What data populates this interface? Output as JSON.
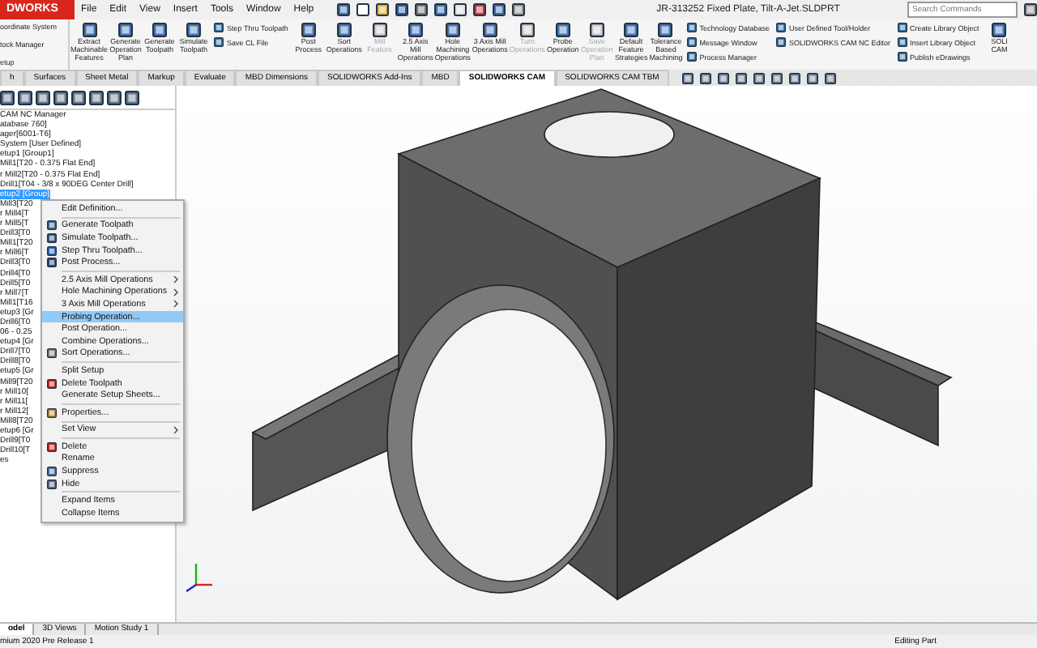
{
  "app": {
    "logo": "DWORKS",
    "menu": [
      "File",
      "Edit",
      "View",
      "Insert",
      "Tools",
      "Window",
      "Help"
    ],
    "title": "JR-313252 Fixed Plate, Tilt-A-Jet.SLDPRT",
    "search": {
      "placeholder": "Search Commands"
    }
  },
  "ribbon": {
    "left_items": [
      "oordinate System",
      "tock Manager",
      "etup"
    ],
    "buttons": [
      {
        "kind": "large",
        "label": "Extract Machinable Features",
        "disabled": false
      },
      {
        "kind": "large",
        "label": "Generate Operation Plan",
        "disabled": false
      },
      {
        "kind": "large",
        "label": "Generate Toolpath",
        "disabled": false
      },
      {
        "kind": "large",
        "label": "Simulate Toolpath",
        "disabled": false
      },
      {
        "kind": "stack",
        "items": [
          "Step Thru Toolpath",
          "Save CL File"
        ]
      },
      {
        "kind": "large",
        "label": "Post Process",
        "disabled": false
      },
      {
        "kind": "large",
        "label": "Sort Operations",
        "disabled": false
      },
      {
        "kind": "large",
        "label": "Mill Feature",
        "disabled": true
      },
      {
        "kind": "large",
        "label": "2.5 Axis Mill Operations",
        "disabled": false
      },
      {
        "kind": "large",
        "label": "Hole Machining Operations",
        "disabled": false
      },
      {
        "kind": "large",
        "label": "3 Axis Mill Operations",
        "disabled": false
      },
      {
        "kind": "large",
        "label": "Turn Operations",
        "disabled": true
      },
      {
        "kind": "large",
        "label": "Probe Operation",
        "disabled": false
      },
      {
        "kind": "large",
        "label": "Save Operation Plan",
        "disabled": true
      },
      {
        "kind": "large",
        "label": "Default Feature Strategies",
        "disabled": false
      },
      {
        "kind": "large",
        "label": "Tolerance Based Machining",
        "disabled": false
      },
      {
        "kind": "stack",
        "items": [
          "Technology Database",
          "Message Window",
          "Process Manager"
        ]
      },
      {
        "kind": "stack",
        "items": [
          "User Defined Tool/Holder",
          "SOLIDWORKS CAM NC Editor"
        ]
      },
      {
        "kind": "stack",
        "items": [
          "Create Library Object",
          "Insert Library Object",
          "Publish eDrawings"
        ]
      },
      {
        "kind": "large",
        "label": "SOLI CAM",
        "disabled": false
      }
    ]
  },
  "tabs": [
    {
      "label": "h",
      "selected": false
    },
    {
      "label": "Surfaces",
      "selected": false
    },
    {
      "label": "Sheet Metal",
      "selected": false
    },
    {
      "label": "Markup",
      "selected": false
    },
    {
      "label": "Evaluate",
      "selected": false
    },
    {
      "label": "MBD Dimensions",
      "selected": false
    },
    {
      "label": "SOLIDWORKS Add-Ins",
      "selected": false
    },
    {
      "label": "MBD",
      "selected": false
    },
    {
      "label": "SOLIDWORKS CAM",
      "selected": true
    },
    {
      "label": "SOLIDWORKS CAM TBM",
      "selected": false
    }
  ],
  "tree": {
    "items": [
      {
        "label": "CAM NC Manager",
        "selected": false
      },
      {
        "label": "atabase 760]",
        "selected": false
      },
      {
        "label": "ager[6001-T6]",
        "selected": false
      },
      {
        "label": "System [User Defined]",
        "selected": false
      },
      {
        "label": "etup1 [Group1]",
        "selected": false
      },
      {
        "label": "Mill1[T20 - 0.375 Flat End]",
        "selected": false
      },
      {
        "label": "r Mill2[T20 - 0.375 Flat End]",
        "selected": false
      },
      {
        "label": "Drill1[T04 - 3/8 x 90DEG Center Drill]",
        "selected": false
      },
      {
        "label": "etup2 [Group]",
        "selected": true
      },
      {
        "label": "Mill3[T20",
        "selected": false
      },
      {
        "label": "r Mill4[T",
        "selected": false
      },
      {
        "label": "r Mill5[T",
        "selected": false
      },
      {
        "label": "Drill3[T0",
        "selected": false
      },
      {
        "label": "Mill1[T20",
        "selected": false
      },
      {
        "label": "r Mill6[T",
        "selected": false
      },
      {
        "label": "Drill3[T0",
        "selected": false
      },
      {
        "label": "Drill4[T0",
        "selected": false
      },
      {
        "label": "Drill5[T0",
        "selected": false
      },
      {
        "label": "r Mill7[T",
        "selected": false
      },
      {
        "label": "Mill1[T16",
        "selected": false
      },
      {
        "label": "etup3 [Gr",
        "selected": false
      },
      {
        "label": "Drill6[T0",
        "selected": false
      },
      {
        "label": "06 - 0.25",
        "selected": false
      },
      {
        "label": "etup4 [Gr",
        "selected": false
      },
      {
        "label": "Drill7[T0",
        "selected": false
      },
      {
        "label": "Drill8[T0",
        "selected": false
      },
      {
        "label": "etup5 [Gr",
        "selected": false
      },
      {
        "label": "Mill9[T20",
        "selected": false
      },
      {
        "label": "r Mill10[",
        "selected": false
      },
      {
        "label": "r Mill11[",
        "selected": false
      },
      {
        "label": "r Mill12[",
        "selected": false
      },
      {
        "label": "Mill8[T20",
        "selected": false
      },
      {
        "label": "etup6 [Gr",
        "selected": false
      },
      {
        "label": "Drill9[T0",
        "selected": false
      },
      {
        "label": "Drill10[T",
        "selected": false
      },
      {
        "label": "es",
        "selected": false
      }
    ]
  },
  "context_menu": {
    "items": [
      {
        "kind": "item",
        "label": "Edit Definition...",
        "selected": false,
        "submenu": false
      },
      {
        "kind": "separator"
      },
      {
        "kind": "item",
        "label": "Generate Toolpath",
        "selected": false,
        "submenu": false
      },
      {
        "kind": "item",
        "label": "Simulate Toolpath...",
        "selected": false,
        "submenu": false
      },
      {
        "kind": "item",
        "label": "Step Thru Toolpath...",
        "selected": false,
        "submenu": false
      },
      {
        "kind": "item",
        "label": "Post Process...",
        "selected": false,
        "submenu": false
      },
      {
        "kind": "separator"
      },
      {
        "kind": "item",
        "label": "2.5 Axis Mill Operations",
        "selected": false,
        "submenu": true
      },
      {
        "kind": "item",
        "label": "Hole Machining Operations",
        "selected": false,
        "submenu": true
      },
      {
        "kind": "item",
        "label": "3 Axis Mill Operations",
        "selected": false,
        "submenu": true
      },
      {
        "kind": "item",
        "label": "Probing Operation...",
        "selected": true,
        "submenu": false
      },
      {
        "kind": "item",
        "label": "Post Operation...",
        "selected": false,
        "submenu": false
      },
      {
        "kind": "item",
        "label": "Combine Operations...",
        "selected": false,
        "submenu": false
      },
      {
        "kind": "item",
        "label": "Sort Operations...",
        "selected": false,
        "submenu": false
      },
      {
        "kind": "separator"
      },
      {
        "kind": "item",
        "label": "Split Setup",
        "selected": false,
        "submenu": false
      },
      {
        "kind": "item",
        "label": "Delete Toolpath",
        "selected": false,
        "submenu": false
      },
      {
        "kind": "item",
        "label": "Generate Setup Sheets...",
        "selected": false,
        "submenu": false
      },
      {
        "kind": "separator"
      },
      {
        "kind": "item",
        "label": "Properties...",
        "selected": false,
        "submenu": false
      },
      {
        "kind": "separator"
      },
      {
        "kind": "item",
        "label": "Set View",
        "selected": false,
        "submenu": true
      },
      {
        "kind": "separator"
      },
      {
        "kind": "item",
        "label": "Delete",
        "selected": false,
        "submenu": false
      },
      {
        "kind": "item",
        "label": "Rename",
        "selected": false,
        "submenu": false
      },
      {
        "kind": "item",
        "label": "Suppress",
        "selected": false,
        "submenu": false
      },
      {
        "kind": "item",
        "label": "Hide",
        "selected": false,
        "submenu": false
      },
      {
        "kind": "separator"
      },
      {
        "kind": "item",
        "label": "Expand Items",
        "selected": false,
        "submenu": false
      },
      {
        "kind": "item",
        "label": "Collapse Items",
        "selected": false,
        "submenu": false
      }
    ]
  },
  "bottom_tabs": [
    {
      "label": "odel",
      "selected": true
    },
    {
      "label": "3D Views",
      "selected": false
    },
    {
      "label": "Motion Study 1",
      "selected": false
    }
  ],
  "status_bar": {
    "left": "mium 2020 Pre Release 1",
    "right": "Editing Part"
  }
}
